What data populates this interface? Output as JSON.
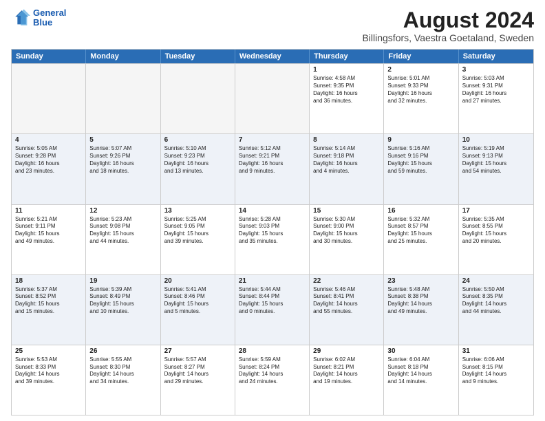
{
  "logo": {
    "line1": "General",
    "line2": "Blue"
  },
  "title": "August 2024",
  "subtitle": "Billingsfors, Vaestra Goetaland, Sweden",
  "header_days": [
    "Sunday",
    "Monday",
    "Tuesday",
    "Wednesday",
    "Thursday",
    "Friday",
    "Saturday"
  ],
  "rows": [
    [
      {
        "day": "",
        "info": ""
      },
      {
        "day": "",
        "info": ""
      },
      {
        "day": "",
        "info": ""
      },
      {
        "day": "",
        "info": ""
      },
      {
        "day": "1",
        "info": "Sunrise: 4:58 AM\nSunset: 9:35 PM\nDaylight: 16 hours\nand 36 minutes."
      },
      {
        "day": "2",
        "info": "Sunrise: 5:01 AM\nSunset: 9:33 PM\nDaylight: 16 hours\nand 32 minutes."
      },
      {
        "day": "3",
        "info": "Sunrise: 5:03 AM\nSunset: 9:31 PM\nDaylight: 16 hours\nand 27 minutes."
      }
    ],
    [
      {
        "day": "4",
        "info": "Sunrise: 5:05 AM\nSunset: 9:28 PM\nDaylight: 16 hours\nand 23 minutes."
      },
      {
        "day": "5",
        "info": "Sunrise: 5:07 AM\nSunset: 9:26 PM\nDaylight: 16 hours\nand 18 minutes."
      },
      {
        "day": "6",
        "info": "Sunrise: 5:10 AM\nSunset: 9:23 PM\nDaylight: 16 hours\nand 13 minutes."
      },
      {
        "day": "7",
        "info": "Sunrise: 5:12 AM\nSunset: 9:21 PM\nDaylight: 16 hours\nand 9 minutes."
      },
      {
        "day": "8",
        "info": "Sunrise: 5:14 AM\nSunset: 9:18 PM\nDaylight: 16 hours\nand 4 minutes."
      },
      {
        "day": "9",
        "info": "Sunrise: 5:16 AM\nSunset: 9:16 PM\nDaylight: 15 hours\nand 59 minutes."
      },
      {
        "day": "10",
        "info": "Sunrise: 5:19 AM\nSunset: 9:13 PM\nDaylight: 15 hours\nand 54 minutes."
      }
    ],
    [
      {
        "day": "11",
        "info": "Sunrise: 5:21 AM\nSunset: 9:11 PM\nDaylight: 15 hours\nand 49 minutes."
      },
      {
        "day": "12",
        "info": "Sunrise: 5:23 AM\nSunset: 9:08 PM\nDaylight: 15 hours\nand 44 minutes."
      },
      {
        "day": "13",
        "info": "Sunrise: 5:25 AM\nSunset: 9:05 PM\nDaylight: 15 hours\nand 39 minutes."
      },
      {
        "day": "14",
        "info": "Sunrise: 5:28 AM\nSunset: 9:03 PM\nDaylight: 15 hours\nand 35 minutes."
      },
      {
        "day": "15",
        "info": "Sunrise: 5:30 AM\nSunset: 9:00 PM\nDaylight: 15 hours\nand 30 minutes."
      },
      {
        "day": "16",
        "info": "Sunrise: 5:32 AM\nSunset: 8:57 PM\nDaylight: 15 hours\nand 25 minutes."
      },
      {
        "day": "17",
        "info": "Sunrise: 5:35 AM\nSunset: 8:55 PM\nDaylight: 15 hours\nand 20 minutes."
      }
    ],
    [
      {
        "day": "18",
        "info": "Sunrise: 5:37 AM\nSunset: 8:52 PM\nDaylight: 15 hours\nand 15 minutes."
      },
      {
        "day": "19",
        "info": "Sunrise: 5:39 AM\nSunset: 8:49 PM\nDaylight: 15 hours\nand 10 minutes."
      },
      {
        "day": "20",
        "info": "Sunrise: 5:41 AM\nSunset: 8:46 PM\nDaylight: 15 hours\nand 5 minutes."
      },
      {
        "day": "21",
        "info": "Sunrise: 5:44 AM\nSunset: 8:44 PM\nDaylight: 15 hours\nand 0 minutes."
      },
      {
        "day": "22",
        "info": "Sunrise: 5:46 AM\nSunset: 8:41 PM\nDaylight: 14 hours\nand 55 minutes."
      },
      {
        "day": "23",
        "info": "Sunrise: 5:48 AM\nSunset: 8:38 PM\nDaylight: 14 hours\nand 49 minutes."
      },
      {
        "day": "24",
        "info": "Sunrise: 5:50 AM\nSunset: 8:35 PM\nDaylight: 14 hours\nand 44 minutes."
      }
    ],
    [
      {
        "day": "25",
        "info": "Sunrise: 5:53 AM\nSunset: 8:33 PM\nDaylight: 14 hours\nand 39 minutes."
      },
      {
        "day": "26",
        "info": "Sunrise: 5:55 AM\nSunset: 8:30 PM\nDaylight: 14 hours\nand 34 minutes."
      },
      {
        "day": "27",
        "info": "Sunrise: 5:57 AM\nSunset: 8:27 PM\nDaylight: 14 hours\nand 29 minutes."
      },
      {
        "day": "28",
        "info": "Sunrise: 5:59 AM\nSunset: 8:24 PM\nDaylight: 14 hours\nand 24 minutes."
      },
      {
        "day": "29",
        "info": "Sunrise: 6:02 AM\nSunset: 8:21 PM\nDaylight: 14 hours\nand 19 minutes."
      },
      {
        "day": "30",
        "info": "Sunrise: 6:04 AM\nSunset: 8:18 PM\nDaylight: 14 hours\nand 14 minutes."
      },
      {
        "day": "31",
        "info": "Sunrise: 6:06 AM\nSunset: 8:15 PM\nDaylight: 14 hours\nand 9 minutes."
      }
    ]
  ]
}
